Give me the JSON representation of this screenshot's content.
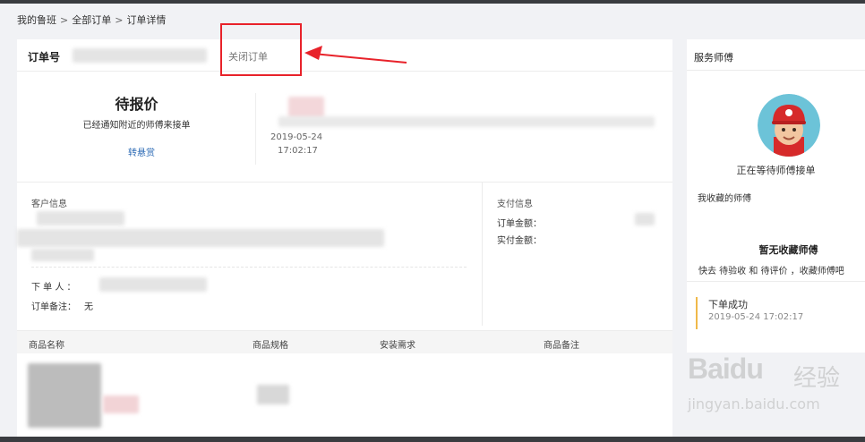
{
  "breadcrumb": {
    "home": "我的鲁班",
    "separator": ">",
    "orders": "全部订单",
    "current": "订单详情"
  },
  "order": {
    "number_label": "订单号",
    "close_label": "关闭订单"
  },
  "status": {
    "title": "待报价",
    "description": "已经通知附近的师傅来接单",
    "reward_link": "转悬赏",
    "date": "2019-05-24",
    "time": "17:02:17"
  },
  "customer": {
    "section_title": "客户信息",
    "orderer_label": "下 单 人 ：",
    "remark_label": "订单备注：",
    "remark_value": "无"
  },
  "payment": {
    "section_title": "支付信息",
    "order_amount_label": "订单金额：",
    "paid_amount_label": "实付金额："
  },
  "table": {
    "headers": [
      "商品名称",
      "商品规格",
      "安装需求",
      "商品备注"
    ]
  },
  "side": {
    "title": "服务师傅",
    "waiting_text": "正在等待师傅接单",
    "favorites_label": "我收藏的师傅",
    "no_favorites": "暂无收藏师傅",
    "favorites_tip": "快去 待验收 和 待评价 ，收藏师傅吧",
    "timeline": [
      {
        "title": "下单成功",
        "time": "2019-05-24 17:02:17"
      }
    ]
  },
  "watermark": {
    "logo": "Baidu",
    "cn": "经验",
    "url": "jingyan.baidu.com"
  },
  "colors": {
    "annotation": "#e8222a",
    "link": "#2d6bb5",
    "timeline_accent": "#f0b94a",
    "avatar_cap": "#d62a2a"
  }
}
